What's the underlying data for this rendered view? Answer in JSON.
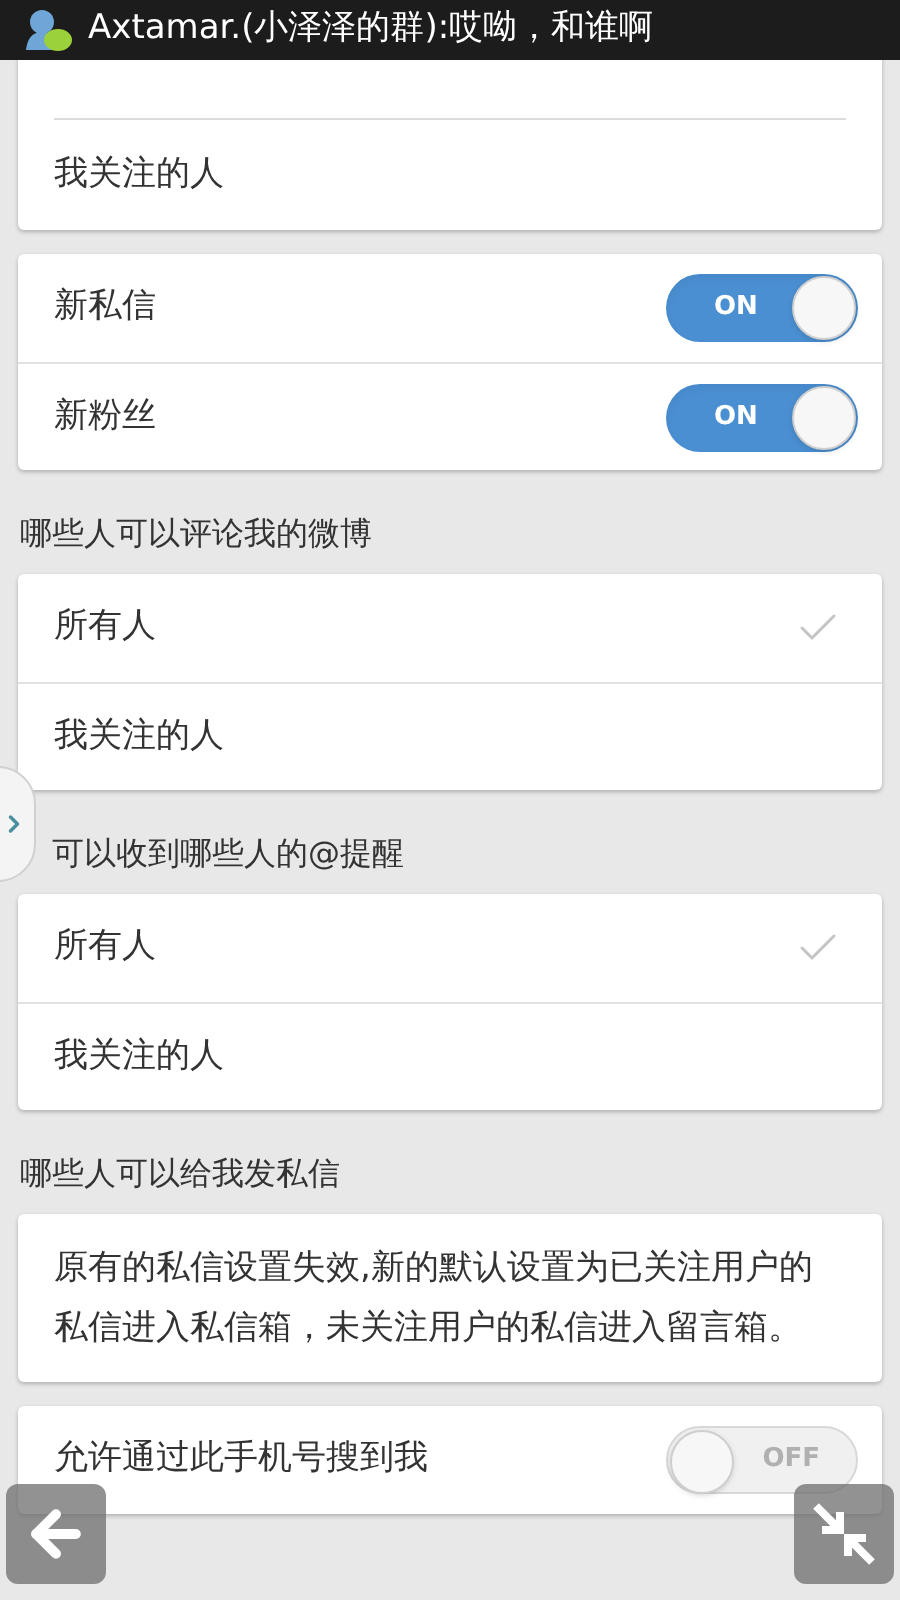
{
  "status_bar": {
    "notification": "Axtamar.(小泽泽的群):哎呦，和谁啊"
  },
  "sections": [
    {
      "kind": "choice",
      "items": [
        {
          "label": "我关注的人",
          "selected": false
        }
      ]
    },
    {
      "kind": "toggles",
      "items": [
        {
          "label": "新私信",
          "on": true,
          "state_label": "ON"
        },
        {
          "label": "新粉丝",
          "on": true,
          "state_label": "ON"
        }
      ]
    },
    {
      "kind": "choice",
      "header": "哪些人可以评论我的微博",
      "items": [
        {
          "label": "所有人",
          "selected": true
        },
        {
          "label": "我关注的人",
          "selected": false
        }
      ]
    },
    {
      "kind": "choice",
      "header": "可以收到哪些人的@提醒",
      "items": [
        {
          "label": "所有人",
          "selected": true
        },
        {
          "label": "我关注的人",
          "selected": false
        }
      ]
    },
    {
      "kind": "note",
      "header": "哪些人可以给我发私信",
      "text": "原有的私信设置失效,新的默认设置为已关注用户的私信进入私信箱，未关注用户的私信进入留言箱。"
    },
    {
      "kind": "toggles",
      "items": [
        {
          "label": "允许通过此手机号搜到我",
          "on": false,
          "state_label": "OFF"
        }
      ]
    }
  ]
}
